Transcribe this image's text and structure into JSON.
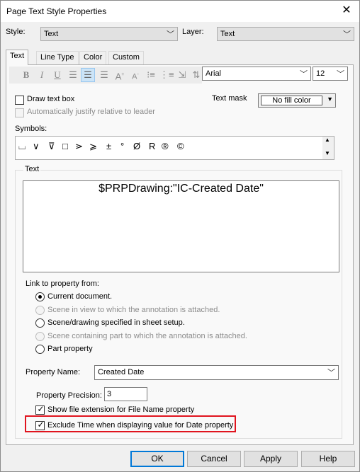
{
  "window": {
    "title": "Page Text Style Properties"
  },
  "style": {
    "label": "Style:",
    "value": "Text"
  },
  "layer": {
    "label": "Layer:",
    "value": "Text"
  },
  "tabs": [
    {
      "label": "Text",
      "active": true
    },
    {
      "label": "Line Type",
      "active": false
    },
    {
      "label": "Color",
      "active": false
    },
    {
      "label": "Custom",
      "active": false
    }
  ],
  "toolbar": {
    "bold": "B",
    "italic": "I",
    "underline": "U",
    "font": "Arial",
    "size": "12"
  },
  "draw_text_box": {
    "label": "Draw text box",
    "checked": false
  },
  "auto_justify": {
    "label": "Automatically justify relative to leader",
    "checked": false,
    "disabled": true
  },
  "text_mask": {
    "label": "Text mask",
    "value": "No fill color"
  },
  "symbols": {
    "label": "Symbols:",
    "items": [
      "⌴",
      "∨",
      "⊽",
      "□",
      "⋗",
      "⩾",
      "±",
      "°",
      "Ø",
      "R",
      "®",
      "©"
    ]
  },
  "text_group": {
    "label": "Text",
    "content": "$PRPDrawing:\"IC-Created Date\""
  },
  "link": {
    "label": "Link to property from:",
    "options": [
      {
        "label": "Current document.",
        "selected": true,
        "disabled": false
      },
      {
        "label": "Scene in view to which the annotation is attached.",
        "selected": false,
        "disabled": true
      },
      {
        "label": "Scene/drawing specified in sheet setup.",
        "selected": false,
        "disabled": false
      },
      {
        "label": "Scene containing part to which the annotation is attached.",
        "selected": false,
        "disabled": true
      },
      {
        "label": "Part property",
        "selected": false,
        "disabled": false
      }
    ]
  },
  "property_name": {
    "label": "Property Name:",
    "value": "Created Date"
  },
  "property_precision": {
    "label": "Property Precision:",
    "value": "3"
  },
  "show_file_ext": {
    "label": "Show file extension for File Name property",
    "checked": true
  },
  "exclude_time": {
    "label": "Exclude Time when displaying value for Date property",
    "checked": true
  },
  "buttons": {
    "ok": "OK",
    "cancel": "Cancel",
    "apply": "Apply",
    "help": "Help"
  },
  "colors": {
    "highlight": "#e0141e",
    "selection": "#cce4f7",
    "default_button": "#0078d7"
  }
}
